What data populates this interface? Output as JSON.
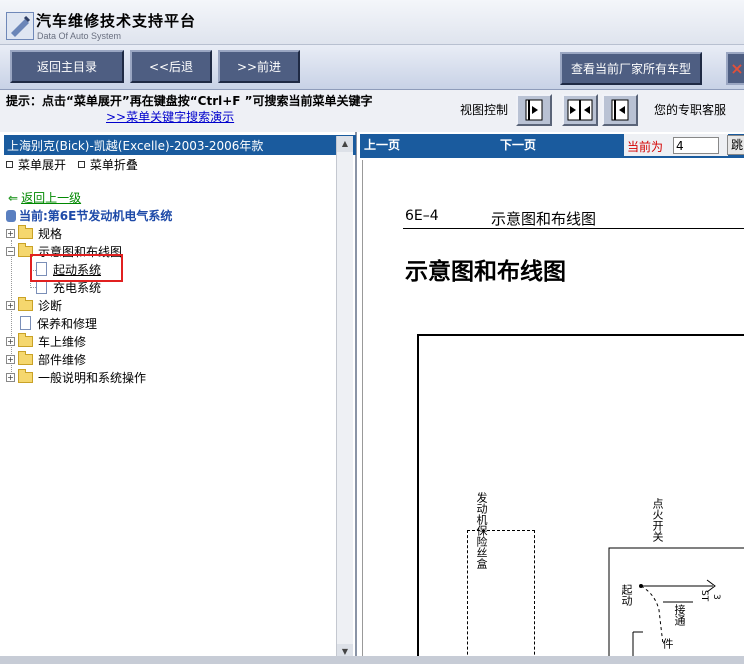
{
  "app": {
    "title": "汽车维修技术支持平台",
    "subtitle": "Data Of Auto System"
  },
  "toolbar": {
    "home": "返回主目录",
    "back": "<<后退",
    "forward": ">>前进",
    "all_models": "查看当前厂家所有车型",
    "close_glyph": "×"
  },
  "hint": {
    "text": "提示：点击“菜单展开”再在键盘按“Ctrl+F ”可搜索当前菜单关键字",
    "link": ">>菜单关键字搜索演示",
    "view_label": "视图控制",
    "support": "您的专职客服"
  },
  "left": {
    "model_header": "上海别克(Bick)-凯越(Excelle)-2003-2006年款",
    "expand": "菜单展开",
    "collapse": "菜单折叠",
    "back_level": "返回上一级",
    "current": "当前:第6E节发动机电气系统",
    "tree": [
      {
        "label": "规格"
      },
      {
        "label": "示意图和布线图"
      },
      {
        "label": "起动系统"
      },
      {
        "label": "充电系统"
      },
      {
        "label": "诊断"
      },
      {
        "label": "保养和修理"
      },
      {
        "label": "车上维修"
      },
      {
        "label": "部件维修"
      },
      {
        "label": "一般说明和系统操作"
      }
    ]
  },
  "right": {
    "prev": "上一页",
    "next": "下一页",
    "current_label": "当前为",
    "current_page": "4",
    "jump": "跳"
  },
  "document": {
    "section_num": "6E–4",
    "section_title": "示意图和布线图",
    "big_title": "示意图和布线图",
    "fuse_label": "发动机保险丝盒",
    "ignition_label": "点火开关",
    "start_label": "起动",
    "on_label": "接通",
    "part_label": "件",
    "st_label": "ST",
    "pin_label": "3"
  }
}
